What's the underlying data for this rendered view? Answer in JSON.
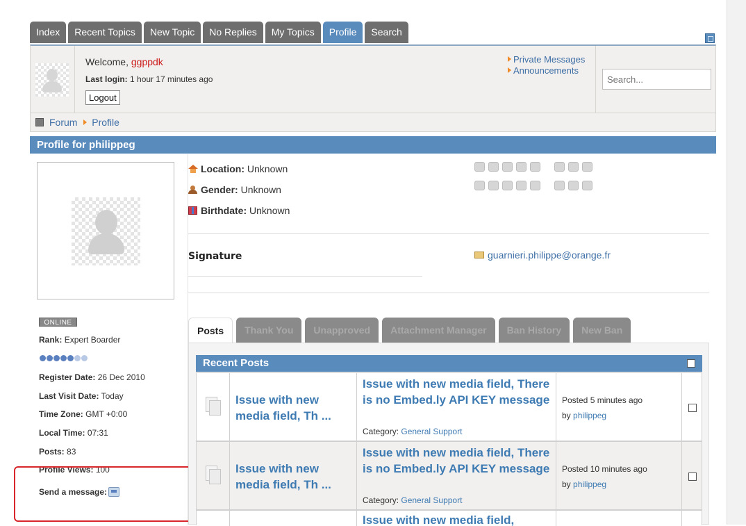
{
  "nav": {
    "tabs": [
      "Index",
      "Recent Topics",
      "New Topic",
      "No Replies",
      "My Topics",
      "Profile",
      "Search"
    ],
    "active": "Profile"
  },
  "header": {
    "welcome_prefix": "Welcome,",
    "username": "ggppdk",
    "last_login_label": "Last login:",
    "last_login_value": "1 hour 17 minutes ago",
    "logout_label": "Logout",
    "links": [
      "Private Messages",
      "Announcements"
    ],
    "search_placeholder": "Search..."
  },
  "breadcrumb": {
    "forum": "Forum",
    "profile": "Profile"
  },
  "profile": {
    "title": "Profile for philippeg",
    "status": "ONLINE",
    "rank_label": "Rank:",
    "rank_value": "Expert Boarder",
    "rank_level": {
      "filled": 5,
      "total": 7
    },
    "register_label": "Register Date:",
    "register_value": "26 Dec 2010",
    "lastvisit_label": "Last Visit Date:",
    "lastvisit_value": "Today",
    "timezone_label": "Time Zone:",
    "timezone_value": "GMT +0:00",
    "localtime_label": "Local Time:",
    "localtime_value": "07:31",
    "posts_label": "Posts:",
    "posts_value": "83",
    "views_label": "Profile Views:",
    "views_value": "100",
    "sendmsg_label": "Send a message:",
    "location_label": "Location:",
    "location_value": "Unknown",
    "gender_label": "Gender:",
    "gender_value": "Unknown",
    "birthdate_label": "Birthdate:",
    "birthdate_value": "Unknown",
    "signature_label": "Signature",
    "email": "guarnieri.philippe@orange.fr"
  },
  "lower_tabs": [
    "Posts",
    "Thank You",
    "Unapproved",
    "Attachment Manager",
    "Ban History",
    "New Ban"
  ],
  "recent_posts": {
    "title": "Recent Posts",
    "rows": [
      {
        "topic": "Issue with new media field, Th ...",
        "subject": "Issue with new media field, There is no Embed.ly API KEY message",
        "category_label": "Category:",
        "category": "General Support",
        "posted": "Posted 5 minutes ago",
        "by_label": "by",
        "author": "philippeg"
      },
      {
        "topic": "Issue with new media field, Th ...",
        "subject": "Issue with new media field, There is no Embed.ly API KEY message",
        "category_label": "Category:",
        "category": "General Support",
        "posted": "Posted 10 minutes ago",
        "by_label": "by",
        "author": "philippeg"
      },
      {
        "subject": "Issue with new media field,"
      }
    ]
  },
  "colors": {
    "accent": "#5a8bbd",
    "link": "#3f6fa6",
    "username": "#cc1a1a",
    "highlight_frame": "#d9262c"
  }
}
